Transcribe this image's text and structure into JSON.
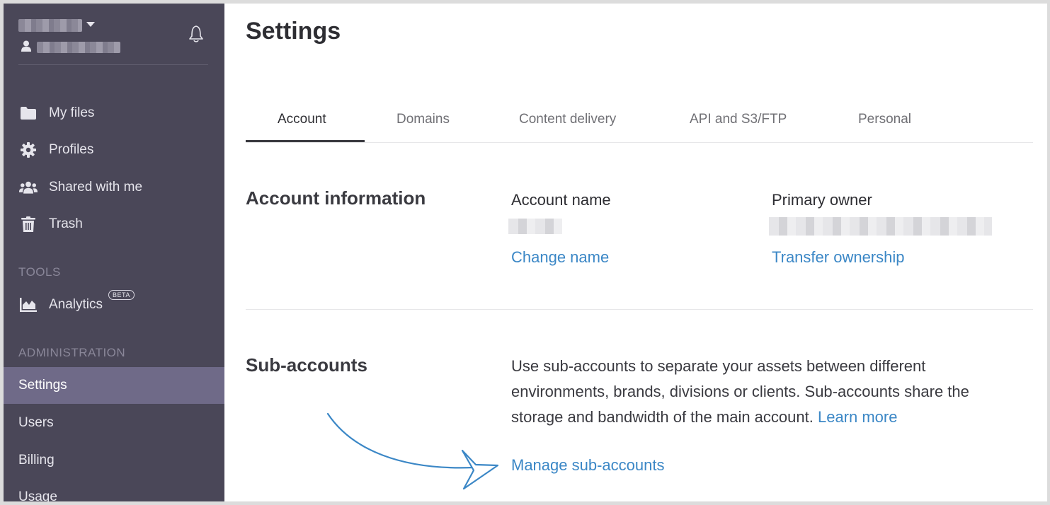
{
  "sidebar": {
    "nav": [
      {
        "label": "My files",
        "icon": "folder-icon"
      },
      {
        "label": "Profiles",
        "icon": "gear-icon"
      },
      {
        "label": "Shared with me",
        "icon": "users-icon"
      },
      {
        "label": "Trash",
        "icon": "trash-icon"
      }
    ],
    "tools_label": "TOOLS",
    "analytics": {
      "label": "Analytics",
      "badge": "BETA",
      "icon": "chart-icon"
    },
    "admin_label": "ADMINISTRATION",
    "admin_items": [
      {
        "label": "Settings",
        "active": true
      },
      {
        "label": "Users"
      },
      {
        "label": "Billing"
      },
      {
        "label": "Usage"
      }
    ]
  },
  "main": {
    "title": "Settings",
    "tabs": [
      {
        "label": "Account",
        "active": true
      },
      {
        "label": "Domains"
      },
      {
        "label": "Content delivery"
      },
      {
        "label": "API and S3/FTP"
      },
      {
        "label": "Personal"
      }
    ],
    "account_info": {
      "title": "Account information",
      "account_name_label": "Account name",
      "change_name": "Change name",
      "primary_owner_label": "Primary owner",
      "transfer_ownership": "Transfer ownership"
    },
    "sub_accounts": {
      "title": "Sub-accounts",
      "description": "Use sub-accounts to separate your assets between different environments, brands, divisions or clients. Sub-accounts share the storage and bandwidth of the main account.",
      "learn_more": "Learn more",
      "manage": "Manage sub-accounts"
    }
  },
  "colors": {
    "sidebar_bg": "#4a4758",
    "sidebar_active": "#6f6a88",
    "link": "#3b87c6",
    "annotation_arrow": "#3b87c6"
  }
}
